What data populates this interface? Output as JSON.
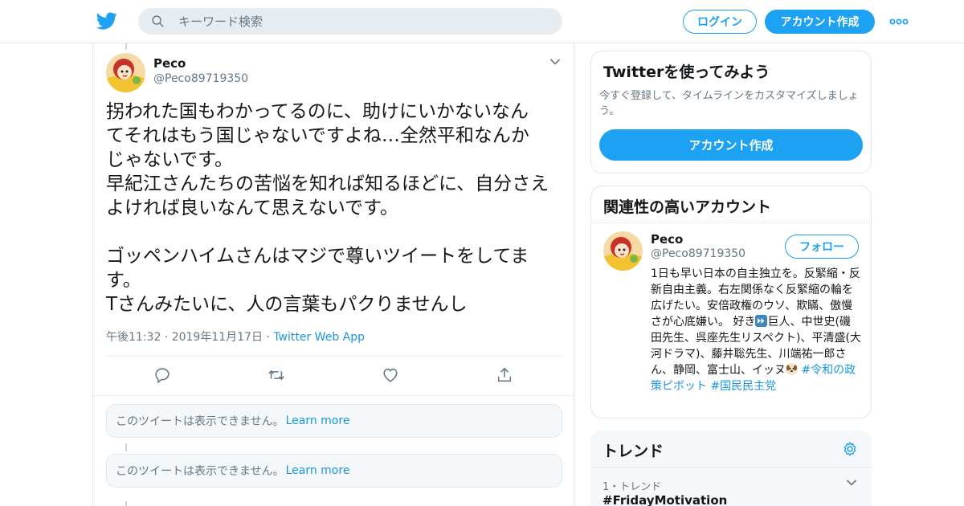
{
  "colors": {
    "accent": "#1da1f2",
    "link": "#1b95e0",
    "muted": "#657786",
    "border": "#e1e8ed"
  },
  "header": {
    "logo_icon": "twitter-bird-icon",
    "search_placeholder": "キーワード検索",
    "login_label": "ログイン",
    "signup_label": "アカウント作成",
    "more_icon": "more-dots-icon"
  },
  "tweet": {
    "author_name": "Peco",
    "author_handle": "@Peco89719350",
    "text": "拐われた国もわかってるのに、助けにいかないなん\nてそれはもう国じゃないですよね…全然平和なんか\nじゃないです。\n早紀江さんたちの苦悩を知れば知るほどに、自分さえ\nよければ良いなんて思えないです。\n\nゴッペンハイムさんはマジで尊いツイートをしてま\nす。\nTさんみたいに、人の言葉もパクりませんし",
    "timestamp": "午後11:32 · 2019年11月17日 ·",
    "source": "Twitter Web App",
    "action_icons": [
      "reply-icon",
      "retweet-icon",
      "like-icon",
      "share-icon"
    ]
  },
  "unavailable": [
    {
      "text": "このツイートは表示できません。",
      "link": "Learn more"
    },
    {
      "text": "このツイートは表示できません。",
      "link": "Learn more"
    }
  ],
  "sidebar": {
    "signup": {
      "title": "Twitterを使ってみよう",
      "subtitle": "今すぐ登録して、タイムラインをカスタマイズしましょう。",
      "button": "アカウント作成"
    },
    "related": {
      "title": "関連性の高いアカウント",
      "name": "Peco",
      "handle": "@Peco89719350",
      "follow_label": "フォロー",
      "bio_text": "1日も早い日本の自主独立を。反緊縮・反新自由主義。右左関係なく反緊縮の輪を広げたい。安倍政権のウソ、欺瞞、傲慢さが心底嫌い。 好き",
      "bio_text_2": "巨人、中世史(磯田先生、呉座先生リスペクト)、平清盛(大河ドラマ)、藤井聡先生、川端祐一郎さん、静岡、富士山、イッヌ",
      "bio_tags": "#令和の政策ピボット #国民民主党"
    },
    "trends": {
      "title": "トレンド",
      "rank": "1・トレンド",
      "name": "#FridayMotivation"
    }
  }
}
